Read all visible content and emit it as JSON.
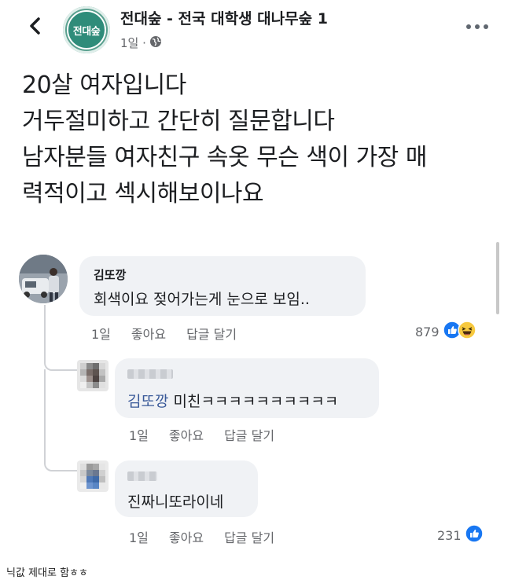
{
  "header": {
    "page_name": "전대숲 - 전국 대학생 대나무숲 1",
    "avatar_text": "전대숲",
    "time": "1일 ·"
  },
  "post": {
    "lines": [
      "20살 여자입니다",
      "거두절미하고 간단히 질문합니다",
      "남자분들 여자친구 속옷 무슨 색이 가장 매",
      "력적이고 섹시해보이나요"
    ]
  },
  "comments": [
    {
      "name": "김또깡",
      "text": "회색이요 젖어가는게 눈으로 보임..",
      "time": "1일",
      "like": "좋아요",
      "reply": "답글 달기",
      "count": "879"
    }
  ],
  "replies": [
    {
      "mention": "김또깡",
      "text": " 미친ㅋㅋㅋㅋㅋㅋㅋㅋㅋㅋ",
      "time": "1일",
      "like": "좋아요",
      "reply": "답글 달기"
    },
    {
      "text": "진짜니또라이네",
      "time": "1일",
      "like": "좋아요",
      "reply": "답글 달기",
      "count": "231"
    }
  ],
  "caption": "닉값 제대로 함ㅎㅎ",
  "colors": {
    "like_blue": "#1877f2",
    "mention_blue": "#385898",
    "haha_yellow": "#f7c93f"
  }
}
